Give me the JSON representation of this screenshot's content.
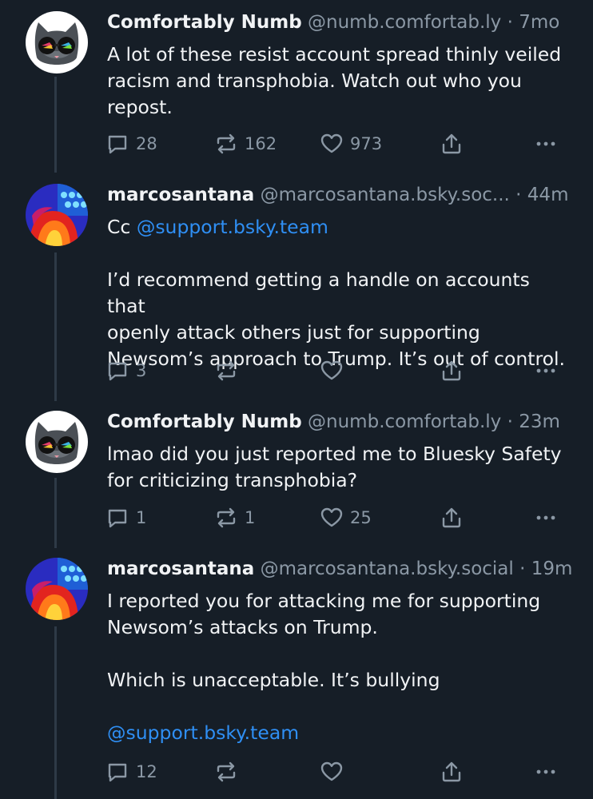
{
  "posts": [
    {
      "author": "Comfortably Numb",
      "handle": "@numb.comfortab.ly",
      "sep": "·",
      "time": "7mo",
      "lines": [
        "A lot of these resist account spread thinly veiled",
        "racism and transphobia. Watch out who you",
        "repost."
      ],
      "replies": "28",
      "reposts": "162",
      "likes": "973",
      "avatar": "cat-sunglasses"
    },
    {
      "author": "marcosantana",
      "handle": "@marcosantana.bsky.soc...",
      "sep": "·",
      "time": "44m",
      "mention_line_prefix": "Cc ",
      "mention": "@support.bsky.team",
      "lines": [
        "I’d recommend getting a handle on accounts that",
        "openly attack others just for supporting",
        "Newsom’s approach to Trump. It’s out of control."
      ],
      "replies": "3",
      "reposts": "",
      "likes": "",
      "avatar": "thermal-photo"
    },
    {
      "author": "Comfortably Numb",
      "handle": "@numb.comfortab.ly",
      "sep": "·",
      "time": "23m",
      "lines": [
        "lmao did you just reported me to Bluesky Safety",
        "for criticizing transphobia?"
      ],
      "replies": "1",
      "reposts": "1",
      "likes": "25",
      "avatar": "cat-sunglasses"
    },
    {
      "author": "marcosantana",
      "handle": "@marcosantana.bsky.social",
      "sep": "·",
      "time": "19m",
      "lines": [
        "I reported you for attacking me for supporting",
        "Newsom’s attacks on Trump."
      ],
      "line2": "Which is unacceptable. It’s bullying",
      "mention": "@support.bsky.team",
      "replies": "12",
      "reposts": "",
      "likes": "",
      "avatar": "thermal-photo"
    }
  ],
  "colors": {
    "background": "#161e27",
    "accent": "#2f8ff4",
    "muted": "#8b98a5",
    "thread": "#2e3a47"
  }
}
